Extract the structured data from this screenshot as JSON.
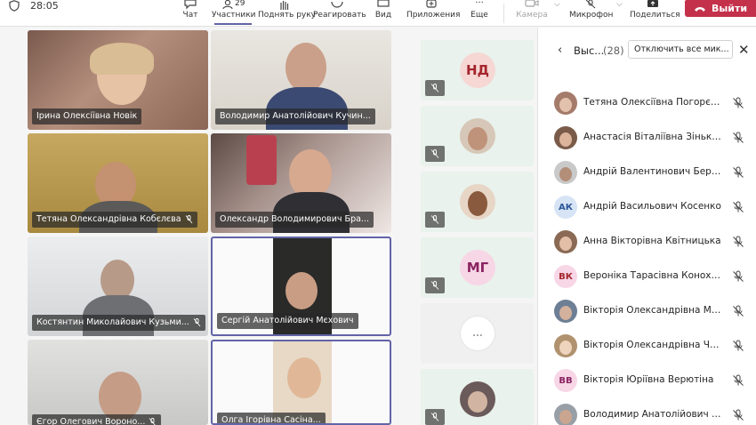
{
  "status": {
    "time": "28:05"
  },
  "toolbar": {
    "chat": "Чат",
    "participants": "Участники",
    "participants_count": "29",
    "raise_hand": "Поднять руку",
    "react": "Реагировать",
    "view": "Вид",
    "apps": "Приложения",
    "more": "Еще",
    "camera": "Камера",
    "mic": "Микрофон",
    "share": "Поделиться",
    "leave": "Выйти"
  },
  "video_tiles": [
    {
      "name": "Ірина Олексіївна Новік"
    },
    {
      "name": "Володимир Анатолійович Кучин..."
    },
    {
      "name": "Тетяна Олександрівна Кобєлєва"
    },
    {
      "name": "Олександр Володимирович Бра..."
    },
    {
      "name": "Костянтин Миколайович Кузьми..."
    },
    {
      "name": "Сергій Анатолійович Мєхович"
    },
    {
      "name": "Єгор Олегович Вороно..."
    },
    {
      "name": "Олга Ігорівна Сасіна..."
    }
  ],
  "middle_tiles": [
    {
      "initials": "НД",
      "color": "#f6d7d4",
      "text_color": "#a4262c"
    },
    {
      "initials": "",
      "color": "",
      "text_color": ""
    },
    {
      "initials": "",
      "color": "",
      "text_color": ""
    },
    {
      "initials": "МГ",
      "color": "#f7d6e6",
      "text_color": "#8a2361"
    },
    {
      "initials": "...",
      "color": "#ffffff",
      "text_color": "#999999"
    },
    {
      "initials": "",
      "color": "",
      "text_color": ""
    }
  ],
  "panel": {
    "title": "Выс...",
    "count": "(28)",
    "mute_all": "Отключить все мик...",
    "participants": [
      {
        "name": "Тетяна Олексіївна Погорєлова",
        "initials": ""
      },
      {
        "name": "Анастасія Віталіївна Зіньковс...",
        "initials": ""
      },
      {
        "name": "Андрій Валентинович Берез...",
        "initials": ""
      },
      {
        "name": "Андрій Васильович Косенко",
        "initials": "АК"
      },
      {
        "name": "Анна Вікторівна Квітницька",
        "initials": ""
      },
      {
        "name": "Вероніка Тарасівна Конохова",
        "initials": "ВК"
      },
      {
        "name": "Вікторія Олександрівна Матр...",
        "initials": ""
      },
      {
        "name": "Вікторія Олександрівна Чере...",
        "initials": ""
      },
      {
        "name": "Вікторія Юріївна Верютіна",
        "initials": "ВВ"
      },
      {
        "name": "Володимир Анатолійович Ку...",
        "initials": ""
      }
    ]
  }
}
